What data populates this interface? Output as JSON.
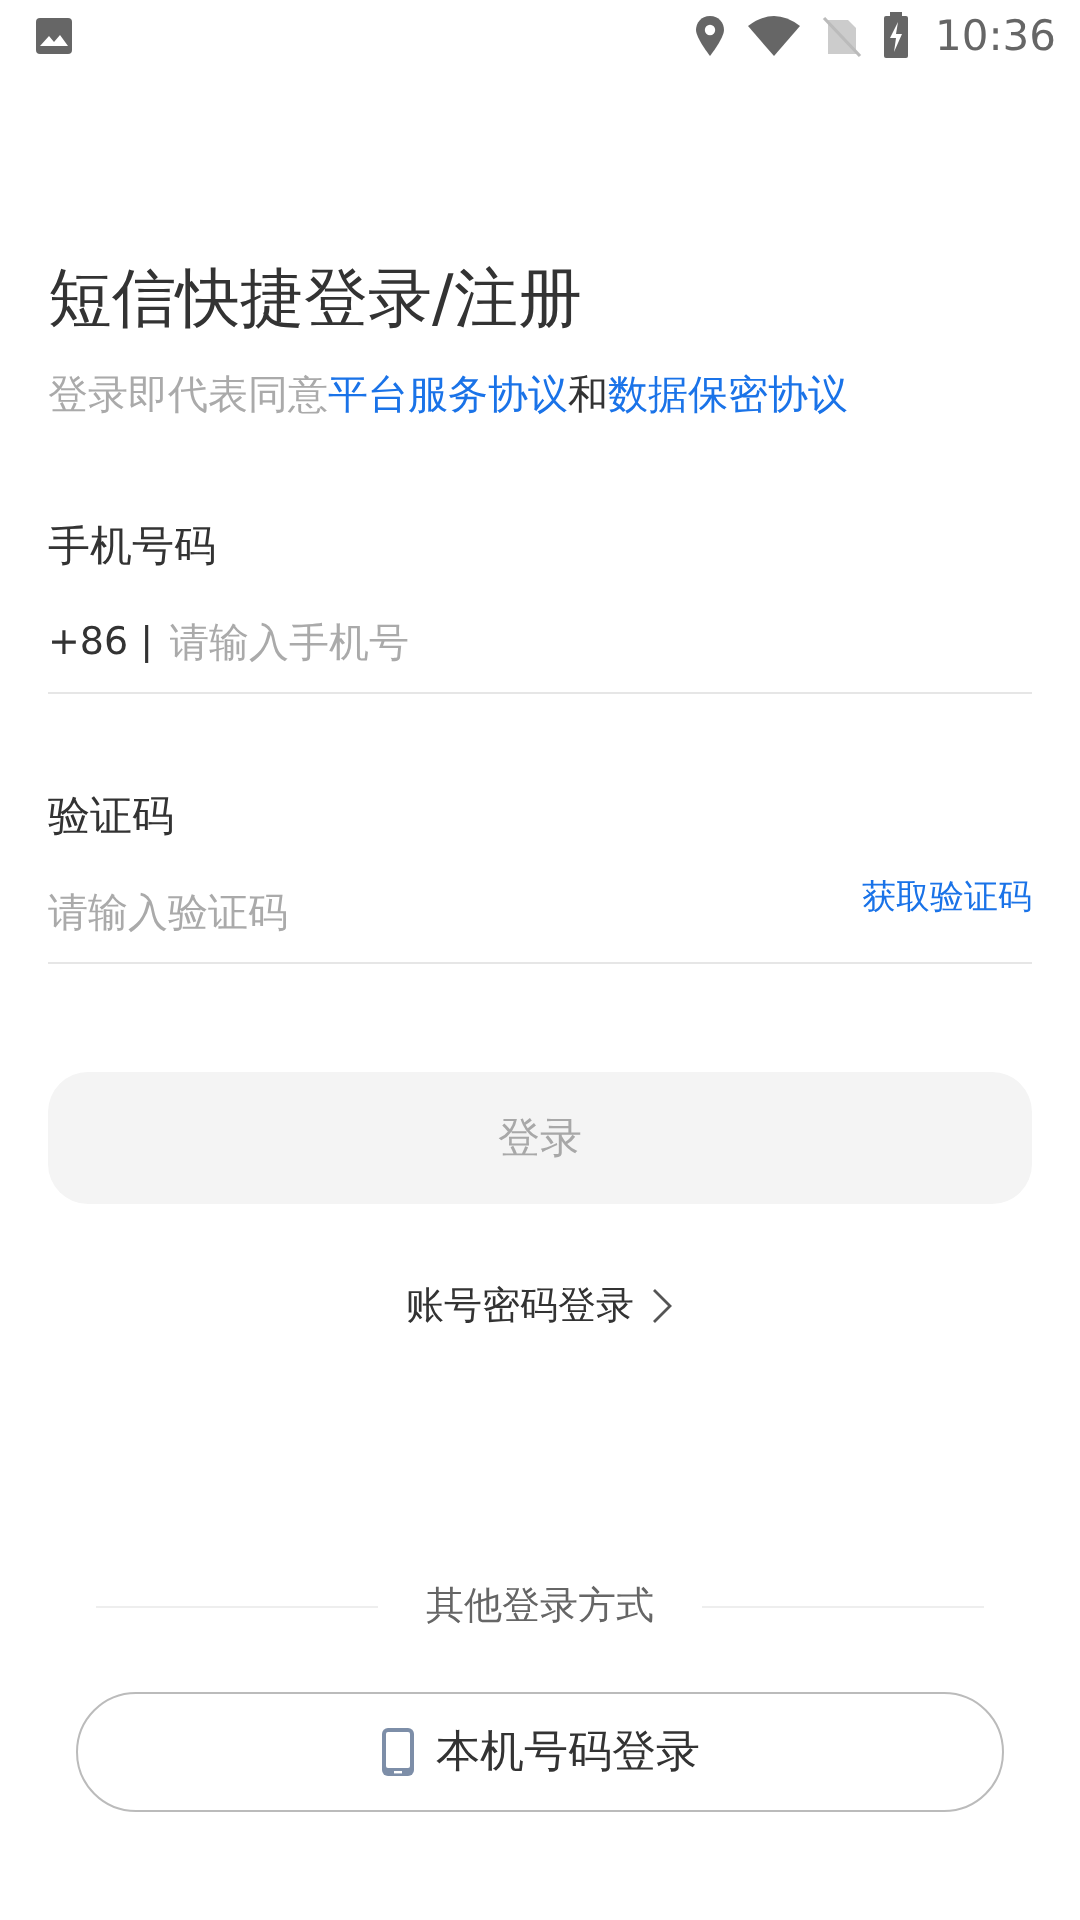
{
  "status_bar": {
    "time": "10:36"
  },
  "title": "短信快捷登录/注册",
  "agreement": {
    "prefix": "登录即代表同意",
    "links": [
      "平台服务协议",
      "数据保密协议"
    ],
    "joiner": "和"
  },
  "phone": {
    "label": "手机号码",
    "prefix": "+86 |",
    "placeholder": "请输入手机号"
  },
  "code": {
    "label": "验证码",
    "placeholder": "请输入验证码",
    "action": "获取验证码"
  },
  "login_button": {
    "label": "登录",
    "disabled": true
  },
  "password_login": {
    "label": "账号密码登录"
  },
  "other_methods": {
    "label": "其他登录方式"
  },
  "local_number_button": {
    "label": "本机号码登录"
  }
}
